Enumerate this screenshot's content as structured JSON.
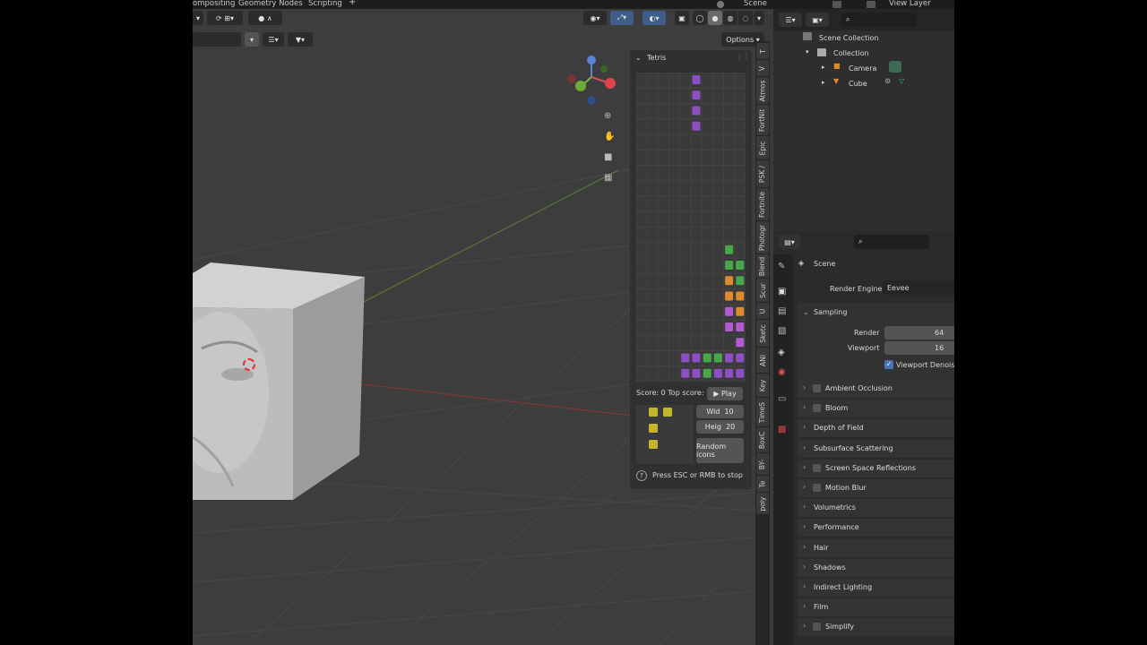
{
  "topbar": {
    "workspaces": [
      "ompositing",
      "Geometry Nodes",
      "Scripting"
    ],
    "add": "+",
    "scene": "Scene",
    "view_layer": "View Layer"
  },
  "viewport_header": {
    "options": "Options"
  },
  "tetris": {
    "title": "Tetris",
    "score_text": "Score: 0 Top score:",
    "play": "Play",
    "width_label": "Wid",
    "width_value": "10",
    "height_label": "Heig",
    "height_value": "20",
    "random_icons": "Random icons",
    "hint": "Press ESC or RMB to stop",
    "colors": {
      "purple": "#8e4fc6",
      "green": "#47a84a",
      "orange": "#e08a2e",
      "pink": "#b25bd0",
      "yellow": "#c4b62c"
    }
  },
  "side_tabs": [
    "T",
    "V",
    "Atmos",
    "FortNit",
    "Epic",
    "PSK /",
    "Fortnite",
    "Photogr",
    "Blend",
    "Scur",
    "U",
    "Sketc",
    "ANI",
    "Key",
    "TimeS",
    "BoxC",
    "BY-",
    "Te",
    "poly"
  ],
  "outliner": {
    "root": "Scene Collection",
    "collection": "Collection",
    "items": [
      "Camera",
      "Cube"
    ]
  },
  "properties": {
    "context": "Scene",
    "render_engine_label": "Render Engine",
    "render_engine_value": "Eevee",
    "sampling": "Sampling",
    "render_label": "Render",
    "render_value": "64",
    "viewport_label": "Viewport",
    "viewport_value": "16",
    "viewport_denoising": "Viewport Denoising",
    "panels": [
      {
        "label": "Ambient Occlusion",
        "checkbox": true
      },
      {
        "label": "Bloom",
        "checkbox": true
      },
      {
        "label": "Depth of Field",
        "checkbox": false
      },
      {
        "label": "Subsurface Scattering",
        "checkbox": false
      },
      {
        "label": "Screen Space Reflections",
        "checkbox": true
      },
      {
        "label": "Motion Blur",
        "checkbox": true
      },
      {
        "label": "Volumetrics",
        "checkbox": false
      },
      {
        "label": "Performance",
        "checkbox": false
      },
      {
        "label": "Hair",
        "checkbox": false
      },
      {
        "label": "Shadows",
        "checkbox": false
      },
      {
        "label": "Indirect Lighting",
        "checkbox": false
      },
      {
        "label": "Film",
        "checkbox": false
      },
      {
        "label": "Simplify",
        "checkbox": true
      }
    ]
  }
}
